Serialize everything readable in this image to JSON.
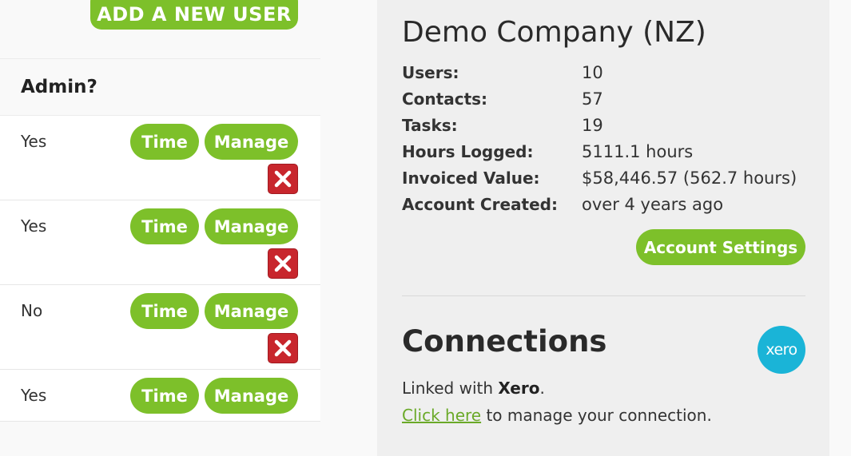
{
  "left": {
    "add_user_label": "ADD A NEW USER",
    "column_header": "Admin?",
    "rows": [
      {
        "admin": "Yes",
        "time_label": "Time",
        "manage_label": "Manage",
        "has_delete": true
      },
      {
        "admin": "Yes",
        "time_label": "Time",
        "manage_label": "Manage",
        "has_delete": true
      },
      {
        "admin": "No",
        "time_label": "Time",
        "manage_label": "Manage",
        "has_delete": true
      },
      {
        "admin": "Yes",
        "time_label": "Time",
        "manage_label": "Manage",
        "has_delete": false
      }
    ]
  },
  "company": {
    "title": "Demo Company (NZ)",
    "stats": [
      {
        "label": "Users:",
        "value": "10"
      },
      {
        "label": "Contacts:",
        "value": "57"
      },
      {
        "label": "Tasks:",
        "value": "19"
      },
      {
        "label": "Hours Logged:",
        "value": "5111.1 hours"
      },
      {
        "label": "Invoiced Value:",
        "value": "$58,446.57 (562.7 hours)"
      },
      {
        "label": "Account Created:",
        "value": "over 4 years ago"
      }
    ],
    "settings_label": "Account Settings"
  },
  "connections": {
    "title": "Connections",
    "logo_text": "xero",
    "linked_prefix": "Linked with ",
    "linked_name": "Xero",
    "linked_suffix": ".",
    "link_text": "Click here",
    "link_suffix": " to manage your connection."
  },
  "colors": {
    "accent_green": "#7dc02a",
    "delete_red": "#c8262d",
    "xero_blue": "#1ab4d7"
  }
}
